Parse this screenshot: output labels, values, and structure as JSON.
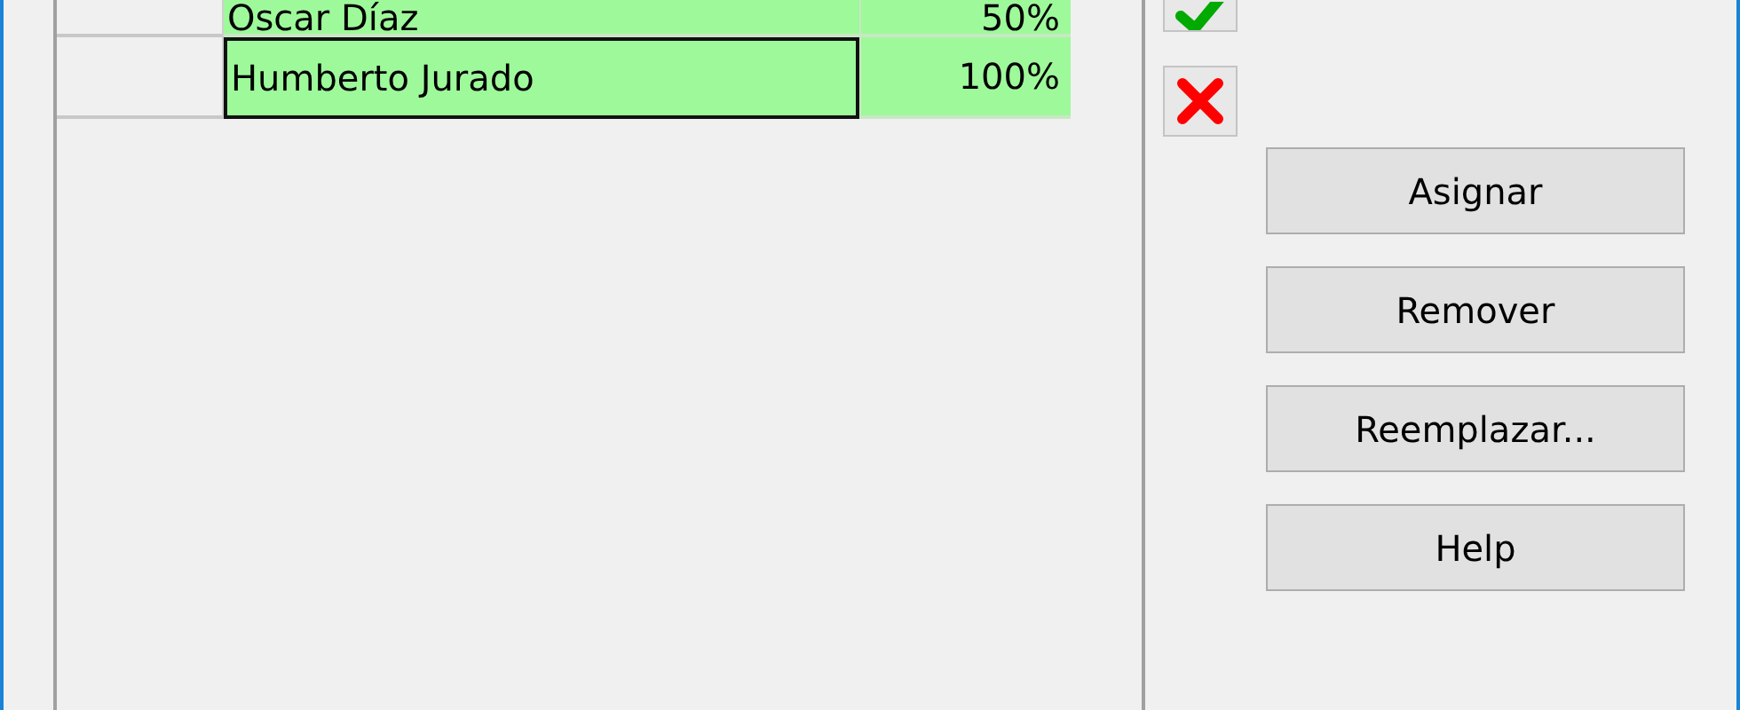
{
  "grid": {
    "rows": [
      {
        "name": "Oscar Díaz",
        "percent": "50%",
        "selected": false
      },
      {
        "name": "Humberto Jurado",
        "percent": "100%",
        "selected": true
      }
    ]
  },
  "buttons": [
    "Asignar",
    "Remover",
    "Reemplazar...",
    "Help"
  ]
}
